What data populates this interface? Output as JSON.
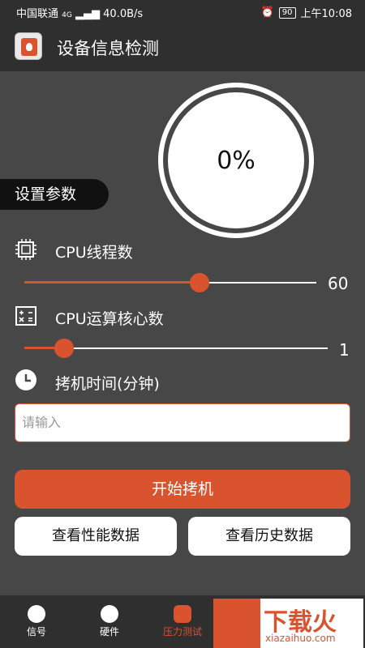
{
  "status": {
    "carrier": "中国联通",
    "network": "4G",
    "speed": "40.0B/s",
    "battery": "90",
    "time": "上午10:08"
  },
  "appbar": {
    "title": "设备信息检测"
  },
  "dial": {
    "percent": "0%"
  },
  "settings_label": "设置参数",
  "threads": {
    "label": "CPU线程数",
    "value": "60",
    "level": 0.6
  },
  "cores": {
    "label": "CPU运算核心数",
    "value": "1",
    "level": 0.13
  },
  "burn_time": {
    "label": "拷机时间(分钟)",
    "placeholder": "请输入",
    "value": ""
  },
  "buttons": {
    "start": "开始拷机",
    "perf": "查看性能数据",
    "history": "查看历史数据"
  },
  "bottom_nav": [
    {
      "label": "信号"
    },
    {
      "label": "硬件"
    },
    {
      "label": "压力测试"
    }
  ],
  "watermark": {
    "text": "下载火",
    "sub": "xiazaihuo.com"
  },
  "colors": {
    "accent": "#d9532e",
    "background": "#474747",
    "bar": "#2f2f2f"
  }
}
